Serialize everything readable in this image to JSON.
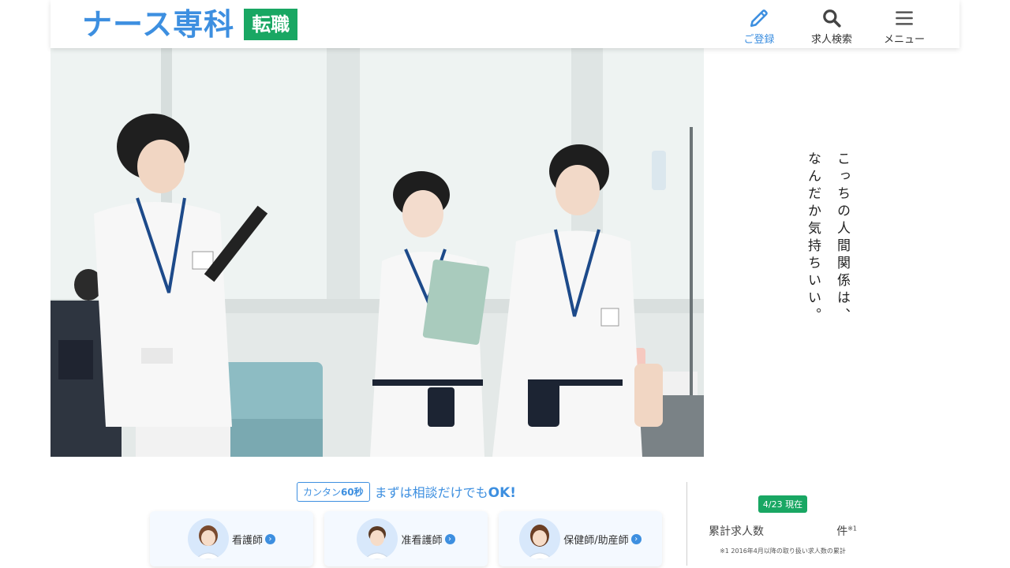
{
  "header": {
    "logo_text": "ナース専科",
    "logo_badge": "転職",
    "nav": [
      {
        "label": "ご登録",
        "icon": "pencil-icon",
        "active": true
      },
      {
        "label": "求人検索",
        "icon": "search-icon",
        "active": false
      },
      {
        "label": "メニュー",
        "icon": "hamburger-menu-icon",
        "active": false
      }
    ]
  },
  "hero": {
    "catchphrase_line1": "こっちの人間関係は、",
    "catchphrase_line2": "なんだか気持ちいい。"
  },
  "cta": {
    "badge_prefix": "カンタン",
    "badge_value": "60秒",
    "text_main": "まずは相談だけでも",
    "text_emphasis": "OK!",
    "cards": [
      {
        "label": "看護師"
      },
      {
        "label": "准看護師"
      },
      {
        "label": "保健師/助産師"
      }
    ]
  },
  "stats": {
    "date": "4/23 現在",
    "label": "累計求人数",
    "unit": "件",
    "note_mark": "※1",
    "note": "※1 2016年4月以降の取り扱い求人数の累計"
  },
  "colors": {
    "brand_blue": "#3d8fe0",
    "brand_green": "#19a763"
  }
}
